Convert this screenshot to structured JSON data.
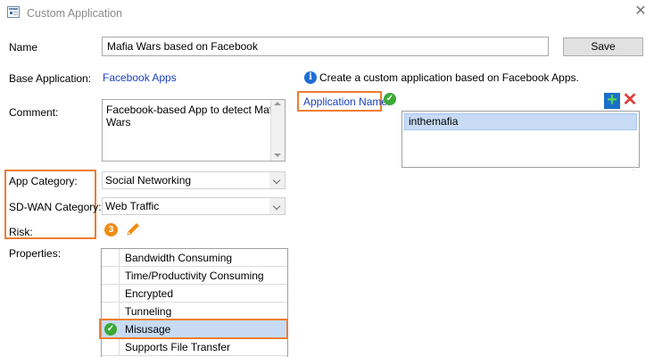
{
  "window": {
    "title": "Custom Application"
  },
  "form": {
    "name_label": "Name",
    "name_value": "Mafia Wars based on Facebook",
    "save_label": "Save",
    "base_label": "Base Application:",
    "base_value": "Facebook Apps",
    "hint_text": "Create a custom application based on Facebook Apps.",
    "comment_label": "Comment:",
    "comment_line1": "Facebook-based App to detect Mafia",
    "comment_line2": "Wars",
    "app_name_label": "Application Name:",
    "app_names": [
      "inthemafia"
    ],
    "category_label": "App Category:",
    "category_value": "Social Networking",
    "sdwan_label": "SD-WAN Category:",
    "sdwan_value": "Web Traffic",
    "risk_label": "Risk:",
    "risk_value": "3",
    "properties_label": "Properties:"
  },
  "properties": [
    {
      "label": "Bandwidth Consuming",
      "checked": false
    },
    {
      "label": "Time/Productivity Consuming",
      "checked": false
    },
    {
      "label": "Encrypted",
      "checked": false
    },
    {
      "label": "Tunneling",
      "checked": false
    },
    {
      "label": "Misusage",
      "checked": true
    },
    {
      "label": "Supports File Transfer",
      "checked": false
    }
  ],
  "icons": {
    "info": "info-icon",
    "check": "check-icon",
    "add": "plus-icon",
    "remove": "x-icon",
    "risk": "risk-badge",
    "edit": "pencil-icon"
  },
  "colors": {
    "highlight": "#ee7d31",
    "link": "#1a3fbf",
    "selection": "#c7dbf5",
    "check": "#3aaa35",
    "risk": "#f08c14"
  }
}
